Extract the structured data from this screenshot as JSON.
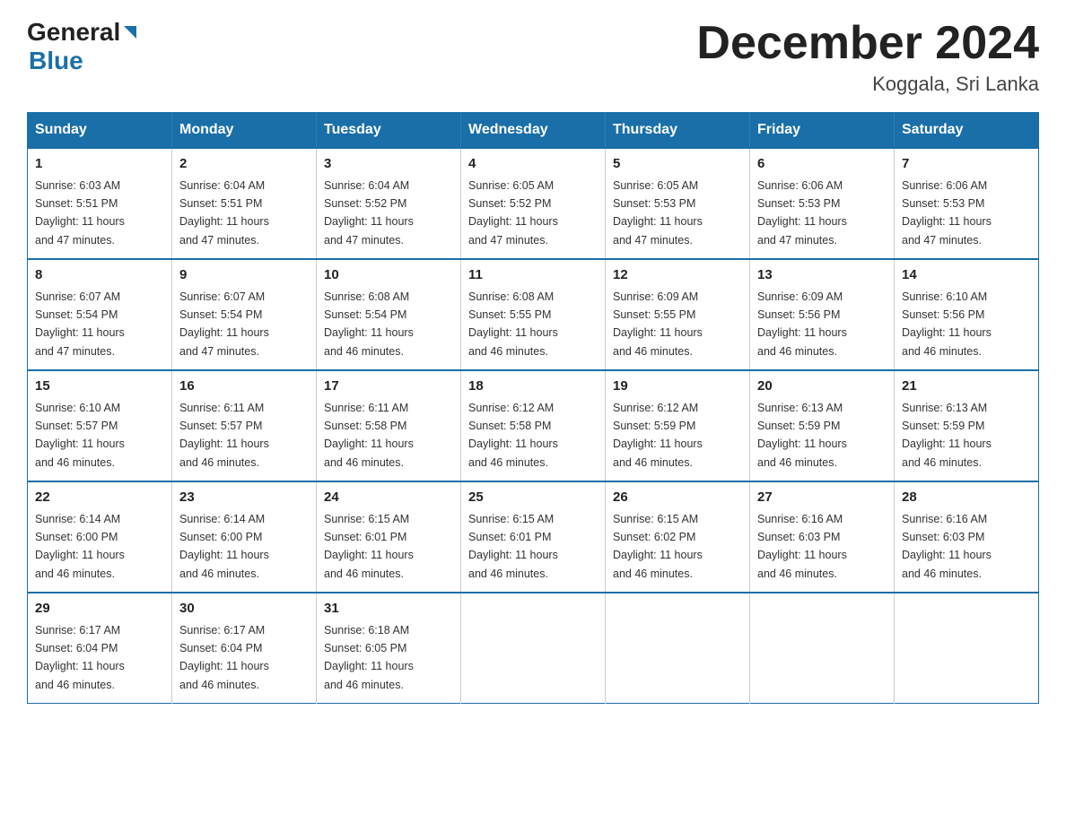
{
  "header": {
    "logo": {
      "general": "General",
      "blue": "Blue"
    },
    "title": "December 2024",
    "subtitle": "Koggala, Sri Lanka"
  },
  "calendar": {
    "days_of_week": [
      "Sunday",
      "Monday",
      "Tuesday",
      "Wednesday",
      "Thursday",
      "Friday",
      "Saturday"
    ],
    "weeks": [
      [
        {
          "day": 1,
          "sunrise": "6:03 AM",
          "sunset": "5:51 PM",
          "daylight": "11 hours and 47 minutes."
        },
        {
          "day": 2,
          "sunrise": "6:04 AM",
          "sunset": "5:51 PM",
          "daylight": "11 hours and 47 minutes."
        },
        {
          "day": 3,
          "sunrise": "6:04 AM",
          "sunset": "5:52 PM",
          "daylight": "11 hours and 47 minutes."
        },
        {
          "day": 4,
          "sunrise": "6:05 AM",
          "sunset": "5:52 PM",
          "daylight": "11 hours and 47 minutes."
        },
        {
          "day": 5,
          "sunrise": "6:05 AM",
          "sunset": "5:53 PM",
          "daylight": "11 hours and 47 minutes."
        },
        {
          "day": 6,
          "sunrise": "6:06 AM",
          "sunset": "5:53 PM",
          "daylight": "11 hours and 47 minutes."
        },
        {
          "day": 7,
          "sunrise": "6:06 AM",
          "sunset": "5:53 PM",
          "daylight": "11 hours and 47 minutes."
        }
      ],
      [
        {
          "day": 8,
          "sunrise": "6:07 AM",
          "sunset": "5:54 PM",
          "daylight": "11 hours and 47 minutes."
        },
        {
          "day": 9,
          "sunrise": "6:07 AM",
          "sunset": "5:54 PM",
          "daylight": "11 hours and 47 minutes."
        },
        {
          "day": 10,
          "sunrise": "6:08 AM",
          "sunset": "5:54 PM",
          "daylight": "11 hours and 46 minutes."
        },
        {
          "day": 11,
          "sunrise": "6:08 AM",
          "sunset": "5:55 PM",
          "daylight": "11 hours and 46 minutes."
        },
        {
          "day": 12,
          "sunrise": "6:09 AM",
          "sunset": "5:55 PM",
          "daylight": "11 hours and 46 minutes."
        },
        {
          "day": 13,
          "sunrise": "6:09 AM",
          "sunset": "5:56 PM",
          "daylight": "11 hours and 46 minutes."
        },
        {
          "day": 14,
          "sunrise": "6:10 AM",
          "sunset": "5:56 PM",
          "daylight": "11 hours and 46 minutes."
        }
      ],
      [
        {
          "day": 15,
          "sunrise": "6:10 AM",
          "sunset": "5:57 PM",
          "daylight": "11 hours and 46 minutes."
        },
        {
          "day": 16,
          "sunrise": "6:11 AM",
          "sunset": "5:57 PM",
          "daylight": "11 hours and 46 minutes."
        },
        {
          "day": 17,
          "sunrise": "6:11 AM",
          "sunset": "5:58 PM",
          "daylight": "11 hours and 46 minutes."
        },
        {
          "day": 18,
          "sunrise": "6:12 AM",
          "sunset": "5:58 PM",
          "daylight": "11 hours and 46 minutes."
        },
        {
          "day": 19,
          "sunrise": "6:12 AM",
          "sunset": "5:59 PM",
          "daylight": "11 hours and 46 minutes."
        },
        {
          "day": 20,
          "sunrise": "6:13 AM",
          "sunset": "5:59 PM",
          "daylight": "11 hours and 46 minutes."
        },
        {
          "day": 21,
          "sunrise": "6:13 AM",
          "sunset": "5:59 PM",
          "daylight": "11 hours and 46 minutes."
        }
      ],
      [
        {
          "day": 22,
          "sunrise": "6:14 AM",
          "sunset": "6:00 PM",
          "daylight": "11 hours and 46 minutes."
        },
        {
          "day": 23,
          "sunrise": "6:14 AM",
          "sunset": "6:00 PM",
          "daylight": "11 hours and 46 minutes."
        },
        {
          "day": 24,
          "sunrise": "6:15 AM",
          "sunset": "6:01 PM",
          "daylight": "11 hours and 46 minutes."
        },
        {
          "day": 25,
          "sunrise": "6:15 AM",
          "sunset": "6:01 PM",
          "daylight": "11 hours and 46 minutes."
        },
        {
          "day": 26,
          "sunrise": "6:15 AM",
          "sunset": "6:02 PM",
          "daylight": "11 hours and 46 minutes."
        },
        {
          "day": 27,
          "sunrise": "6:16 AM",
          "sunset": "6:03 PM",
          "daylight": "11 hours and 46 minutes."
        },
        {
          "day": 28,
          "sunrise": "6:16 AM",
          "sunset": "6:03 PM",
          "daylight": "11 hours and 46 minutes."
        }
      ],
      [
        {
          "day": 29,
          "sunrise": "6:17 AM",
          "sunset": "6:04 PM",
          "daylight": "11 hours and 46 minutes."
        },
        {
          "day": 30,
          "sunrise": "6:17 AM",
          "sunset": "6:04 PM",
          "daylight": "11 hours and 46 minutes."
        },
        {
          "day": 31,
          "sunrise": "6:18 AM",
          "sunset": "6:05 PM",
          "daylight": "11 hours and 46 minutes."
        },
        null,
        null,
        null,
        null
      ]
    ],
    "labels": {
      "sunrise": "Sunrise:",
      "sunset": "Sunset:",
      "daylight": "Daylight:"
    }
  }
}
